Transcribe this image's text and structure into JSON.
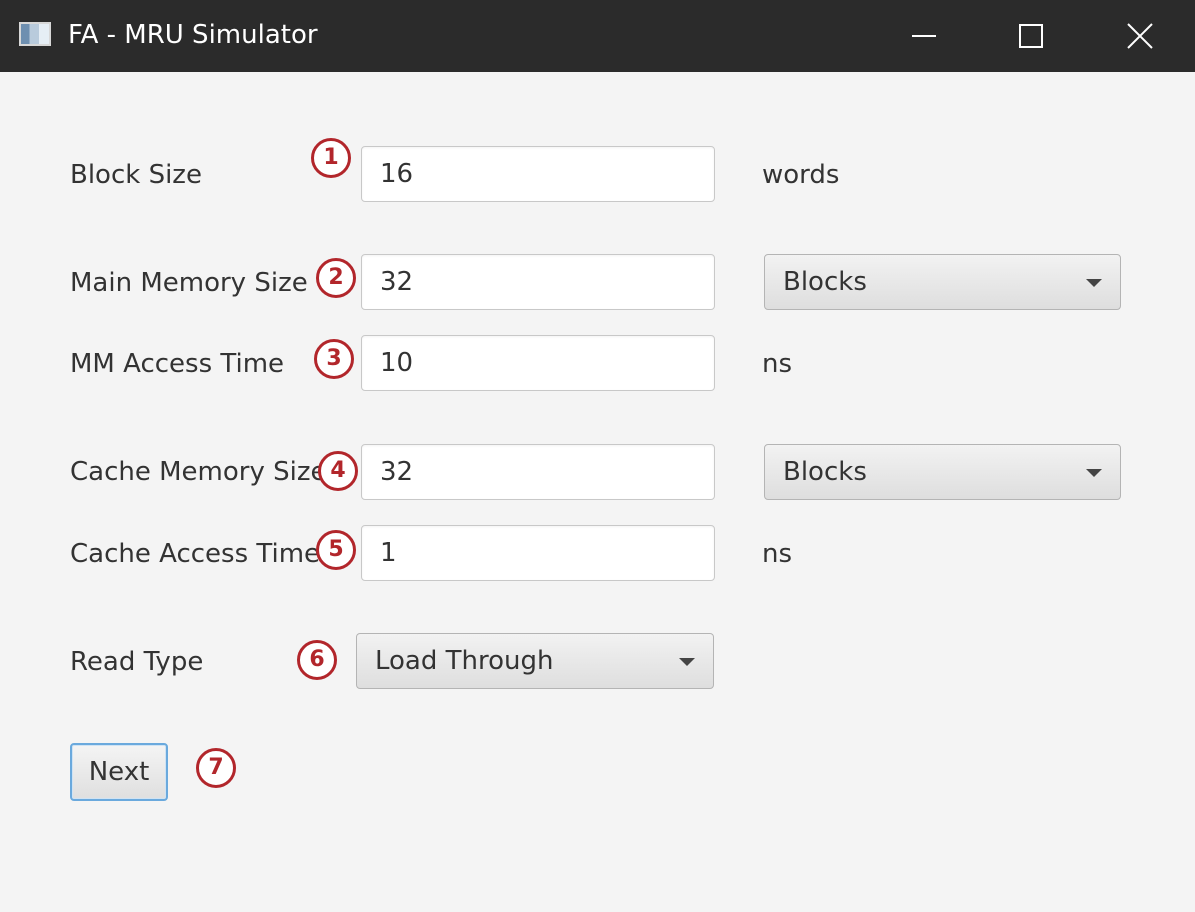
{
  "window": {
    "title": "FA - MRU Simulator"
  },
  "form": {
    "block_size": {
      "label": "Block Size",
      "value": "16",
      "unit": "words",
      "badge": "1"
    },
    "main_memory_size": {
      "label": "Main Memory Size",
      "value": "32",
      "unit_select": "Blocks",
      "badge": "2"
    },
    "mm_access_time": {
      "label": "MM Access Time",
      "value": "10",
      "unit": "ns",
      "badge": "3"
    },
    "cache_memory_size": {
      "label": "Cache Memory Size",
      "value": "32",
      "unit_select": "Blocks",
      "badge": "4"
    },
    "cache_access_time": {
      "label": "Cache Access Time",
      "value": "1",
      "unit": "ns",
      "badge": "5"
    },
    "read_type": {
      "label": "Read Type",
      "value": "Load Through",
      "badge": "6"
    },
    "next": {
      "label": "Next",
      "badge": "7"
    }
  },
  "colors": {
    "titlebar": "#2b2b2b",
    "background": "#f4f4f4",
    "annotation": "#b2262b",
    "focus": "#6aa9dd"
  },
  "icons": [
    "app-icon",
    "minimize-icon",
    "maximize-icon",
    "close-icon",
    "chevron-down-icon"
  ]
}
